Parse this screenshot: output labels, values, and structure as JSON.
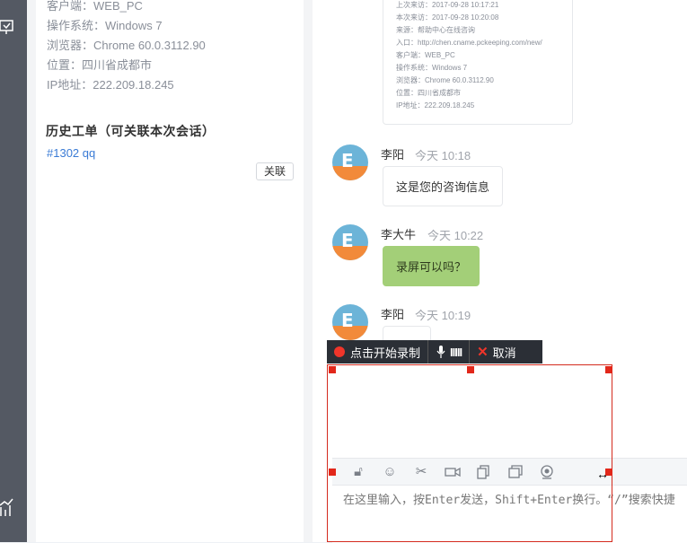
{
  "visitor_info": {
    "client": "客户端：WEB_PC",
    "os": "操作系统：Windows 7",
    "browser": "浏览器：Chrome 60.0.3112.90",
    "location": "位置：四川省成都市",
    "ip": "IP地址：222.209.18.245"
  },
  "history": {
    "title": "历史工单（可关联本次会话）",
    "ticket": "#1302 qq",
    "link_button": "关联"
  },
  "visit_card": {
    "lines": [
      "上次来访：2017-09-28 10:17:21",
      "本次来访：2017-09-28 10:20:08",
      "来源：帮助中心在线咨询",
      "入口：http://chen.cname.pckeeping.com/new/",
      "客户端：WEB_PC",
      "操作系统：Windows 7",
      "浏览器：Chrome 60.0.3112.90",
      "位置：四川省成都市",
      "IP地址：222.209.18.245"
    ]
  },
  "messages": [
    {
      "name": "李阳",
      "time": "今天 10:18",
      "text": "这是您的咨询信息"
    },
    {
      "name": "李大牛",
      "time": "今天 10:22",
      "text": "录屏可以吗？"
    },
    {
      "name": "李阳",
      "time": "今天 10:19",
      "text": ""
    }
  ],
  "recorder": {
    "start_label": "点击开始录制",
    "cancel_label": "取消",
    "level_bars": "IIIII"
  },
  "composer": {
    "placeholder": "在这里输入，按Enter发送，Shift+Enter换行。“/”搜索快捷"
  },
  "colors": {
    "rail": "#545963",
    "accent_link": "#3a7bd5",
    "green_bubble": "#a3cf78",
    "record_red": "#f0352a",
    "selection_red": "#d42b1e"
  }
}
